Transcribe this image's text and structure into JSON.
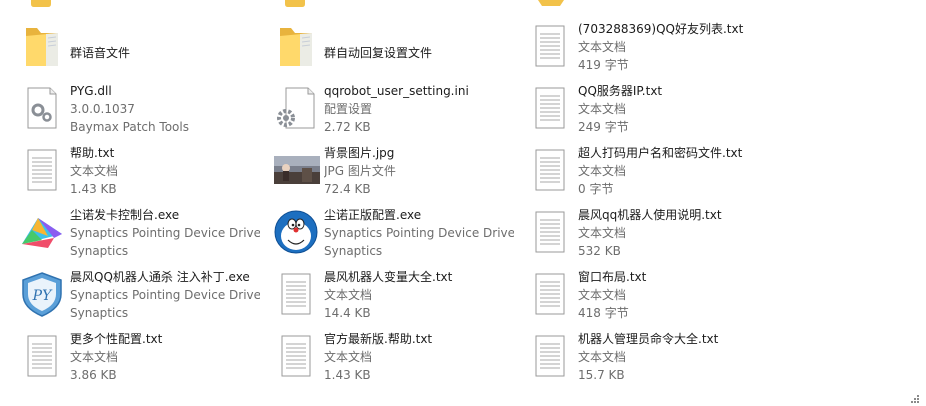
{
  "colors": {
    "name_text": "#1b1b1b",
    "meta_text": "#6d6d6d",
    "folder_yellow": "#f2c24a",
    "folder_front": "#ffd96b",
    "doc_line": "#9a9a9a"
  },
  "files": [
    {
      "name": "群语音文件",
      "kind": "folder",
      "icon": "folder-icon"
    },
    {
      "name": "群自动回复设置文件",
      "kind": "folder",
      "icon": "folder-icon"
    },
    {
      "name": "(703288369)QQ好友列表.txt",
      "type": "文本文档",
      "meta": "419 字节",
      "icon": "text-document-icon"
    },
    {
      "name": "PYG.dll",
      "type": "3.0.0.1037",
      "meta": "Baymax Patch Tools",
      "icon": "dll-gear-file-icon"
    },
    {
      "name": "qqrobot_user_setting.ini",
      "type": "配置设置",
      "meta": "2.72 KB",
      "icon": "ini-settings-file-icon"
    },
    {
      "name": "QQ服务器IP.txt",
      "type": "文本文档",
      "meta": "249 字节",
      "icon": "text-document-icon"
    },
    {
      "name": "帮助.txt",
      "type": "文本文档",
      "meta": "1.43 KB",
      "icon": "text-document-icon"
    },
    {
      "name": "背景图片.jpg",
      "type": "JPG 图片文件",
      "meta": "72.4 KB",
      "icon": "image-thumbnail-icon"
    },
    {
      "name": "超人打码用户名和密码文件.txt",
      "type": "文本文档",
      "meta": "0 字节",
      "icon": "text-document-icon"
    },
    {
      "name": "尘诺发卡控制台.exe",
      "type": "Synaptics Pointing Device Driver",
      "meta": "Synaptics",
      "icon": "colorful-app-exe-icon"
    },
    {
      "name": "尘诺正版配置.exe",
      "type": "Synaptics Pointing Device Driver",
      "meta": "Synaptics",
      "icon": "doraemon-exe-icon"
    },
    {
      "name": "晨风qq机器人使用说明.txt",
      "type": "文本文档",
      "meta": "532 KB",
      "icon": "text-document-icon"
    },
    {
      "name": "晨风QQ机器人通杀 注入补丁.exe",
      "type": "Synaptics Pointing Device Driver",
      "meta": "Synaptics",
      "icon": "py-shield-exe-icon"
    },
    {
      "name": "晨风机器人变量大全.txt",
      "type": "文本文档",
      "meta": "14.4 KB",
      "icon": "text-document-icon"
    },
    {
      "name": "窗口布局.txt",
      "type": "文本文档",
      "meta": "418 字节",
      "icon": "text-document-icon"
    },
    {
      "name": "更多个性配置.txt",
      "type": "文本文档",
      "meta": "3.86 KB",
      "icon": "text-document-icon"
    },
    {
      "name": "官方最新版.帮助.txt",
      "type": "文本文档",
      "meta": "1.43 KB",
      "icon": "text-document-icon"
    },
    {
      "name": "机器人管理员命令大全.txt",
      "type": "文本文档",
      "meta": "15.7 KB",
      "icon": "text-document-icon"
    }
  ]
}
